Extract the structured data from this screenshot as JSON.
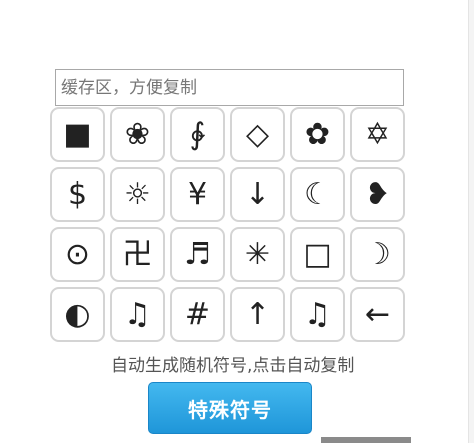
{
  "buffer": {
    "placeholder": "缓存区，方便复制",
    "value": ""
  },
  "symbols": [
    "■",
    "❀",
    "∲",
    "◇",
    "✿",
    "✡",
    "$",
    "☼",
    "¥",
    "↓",
    "☾",
    "❥",
    "⊙",
    "卍",
    "♬",
    "✳",
    "□",
    "☽",
    "◐",
    "♫",
    "#",
    "↑",
    "♫",
    "←"
  ],
  "caption": "自动生成随机符号,点击自动复制",
  "button_label": "特殊符号",
  "colors": {
    "button_top": "#43b8ef",
    "button_bottom": "#1f96d9",
    "cell_border": "#d4d4d4"
  }
}
